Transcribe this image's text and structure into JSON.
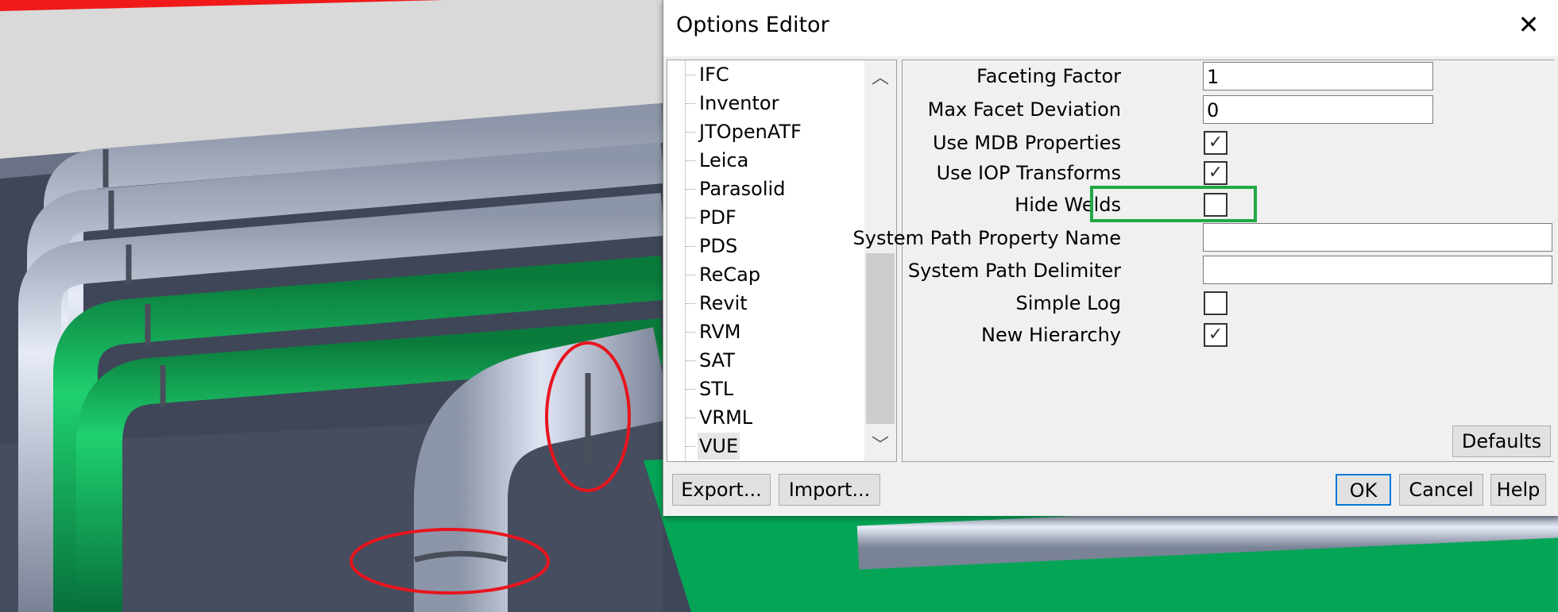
{
  "dialog": {
    "title": "Options Editor",
    "close_icon": "close-icon",
    "tree_items": [
      "IFC",
      "Inventor",
      "JTOpenATF",
      "Leica",
      "Parasolid",
      "PDF",
      "PDS",
      "ReCap",
      "Revit",
      "RVM",
      "SAT",
      "STL",
      "VRML",
      "VUE"
    ],
    "selected_item": "VUE",
    "options": {
      "faceting_factor": {
        "label": "Faceting Factor",
        "value": "1"
      },
      "max_facet_deviation": {
        "label": "Max Facet Deviation",
        "value": "0"
      },
      "use_mdb_properties": {
        "label": "Use MDB Properties",
        "checked": true,
        "mark": "✓"
      },
      "use_iop_transforms": {
        "label": "Use IOP Transforms",
        "checked": true,
        "mark": "✓"
      },
      "hide_welds": {
        "label": "Hide Welds",
        "checked": false,
        "mark": ""
      },
      "system_path_property_name": {
        "label": "System Path Property Name",
        "value": ""
      },
      "system_path_delimiter": {
        "label": "System Path Delimiter",
        "value": ""
      },
      "simple_log": {
        "label": "Simple Log",
        "checked": false,
        "mark": ""
      },
      "new_hierarchy": {
        "label": "New Hierarchy",
        "checked": true,
        "mark": "✓"
      }
    },
    "buttons": {
      "defaults": "Defaults",
      "export": "Export...",
      "import": "Import...",
      "ok": "OK",
      "cancel": "Cancel",
      "help": "Help"
    },
    "highlight_color": "#22a845"
  },
  "annotation_color": "#e8141e"
}
